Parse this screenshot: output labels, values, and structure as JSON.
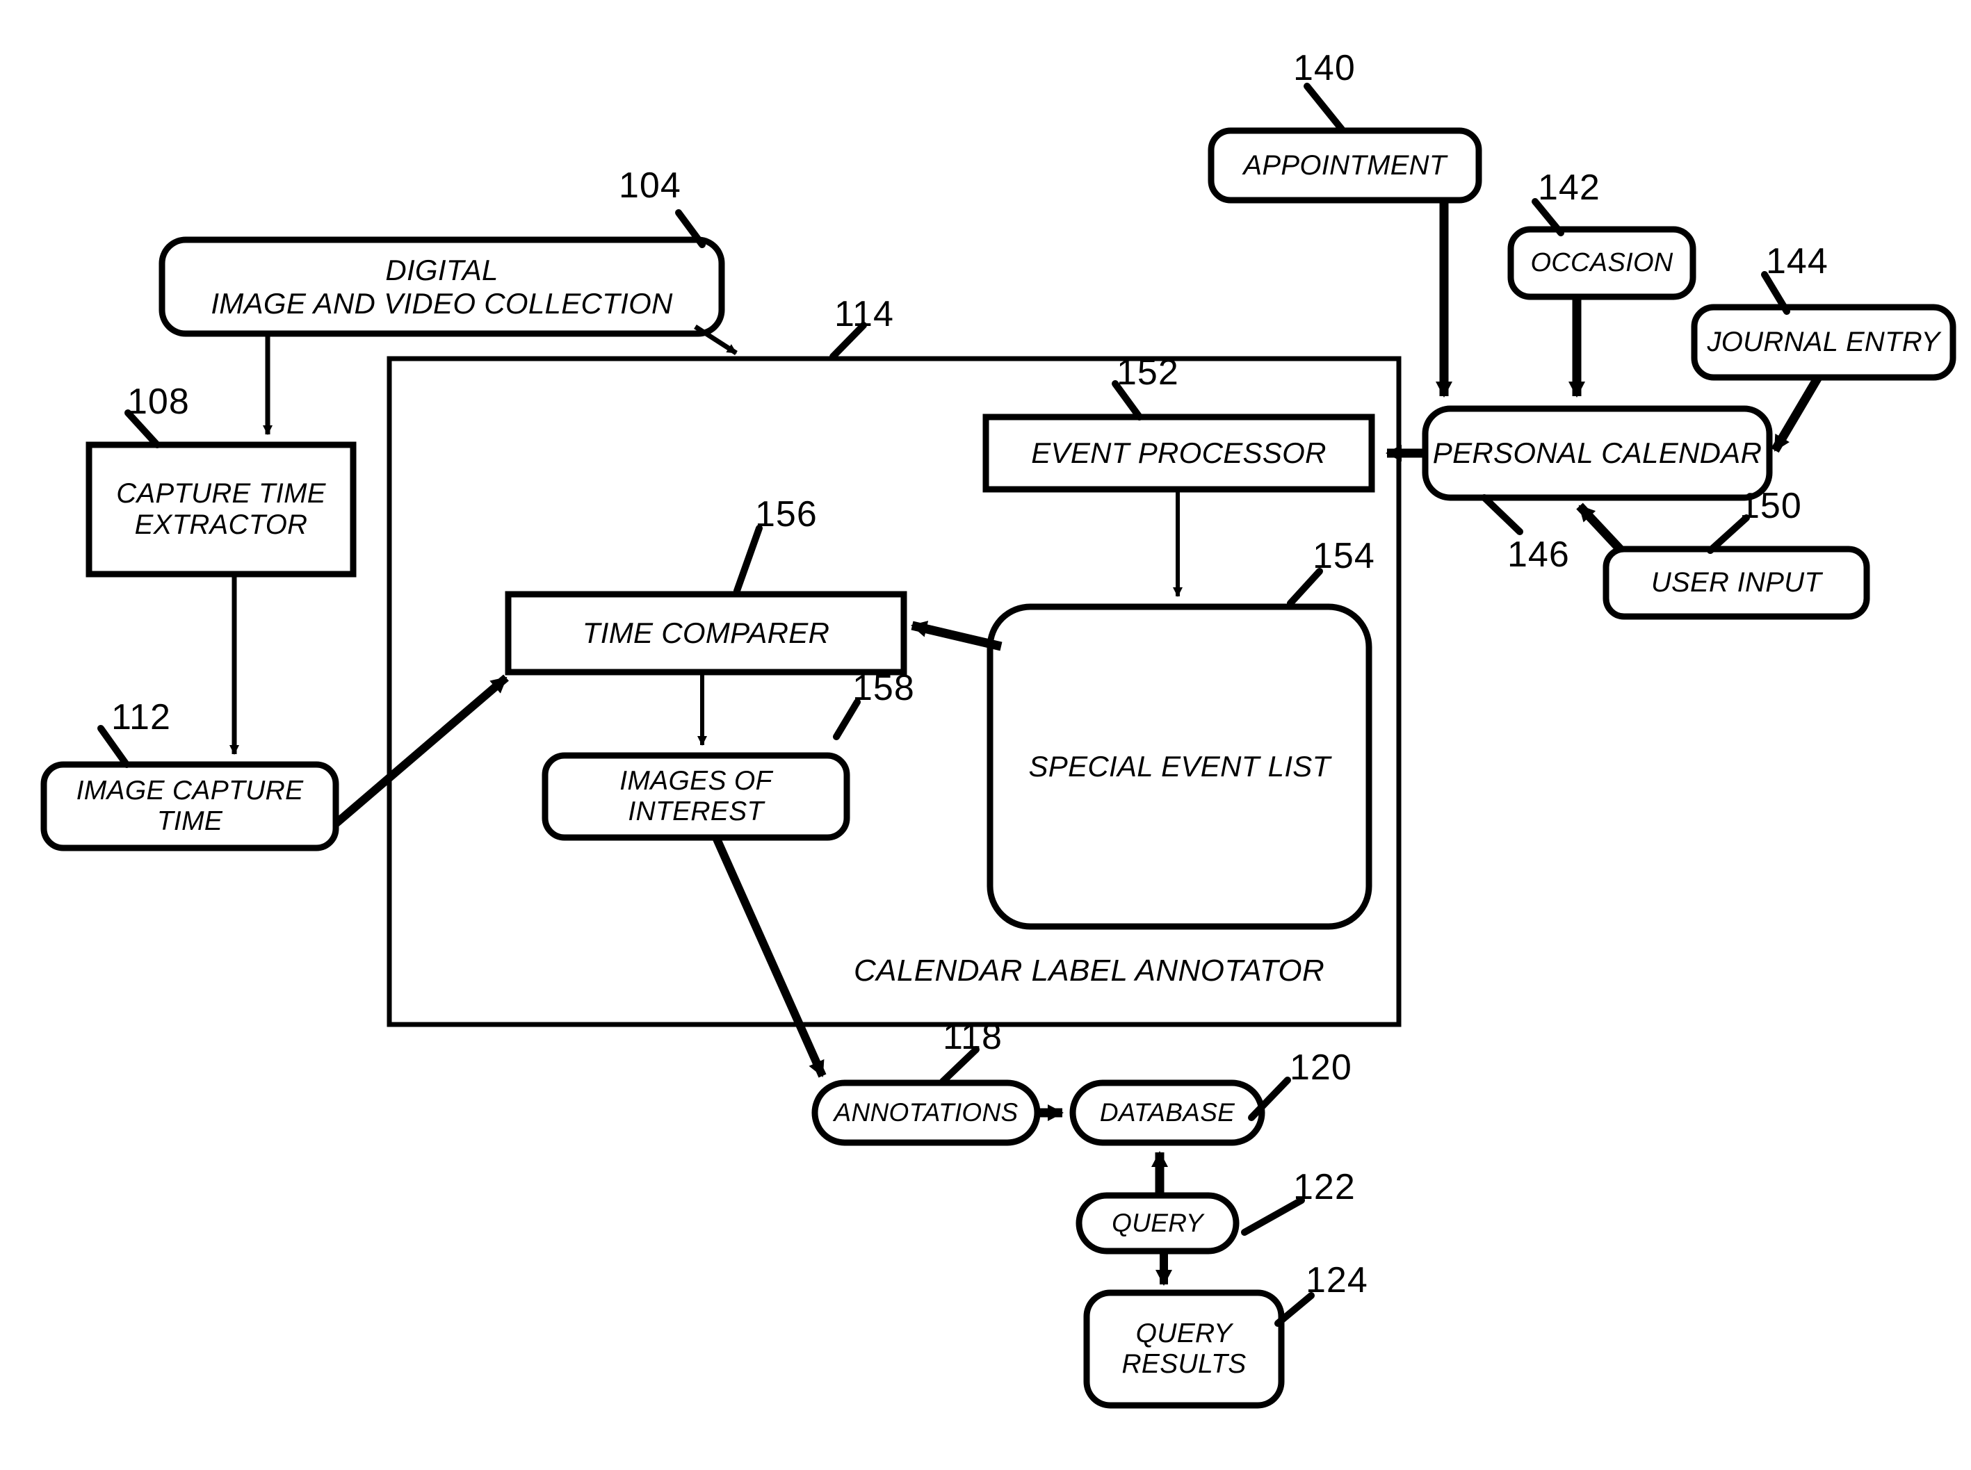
{
  "figure": {
    "type": "patent-block-diagram",
    "background_color": "#ffffff",
    "line_color": "#000000"
  },
  "nodes": {
    "digital_collection": {
      "label": "DIGITAL\nIMAGE AND VIDEO COLLECTION",
      "ref": "104",
      "shape": "rounded-rect"
    },
    "capture_time_extractor": {
      "label": "CAPTURE TIME\nEXTRACTOR",
      "ref": "108",
      "shape": "rect"
    },
    "image_capture_time": {
      "label": "IMAGE CAPTURE\nTIME",
      "ref": "112",
      "shape": "rounded-rect"
    },
    "time_comparer": {
      "label": "TIME COMPARER",
      "ref": "156",
      "shape": "rect"
    },
    "images_of_interest": {
      "label": "IMAGES OF\nINTEREST",
      "ref": "158",
      "shape": "rounded-rect"
    },
    "event_processor": {
      "label": "EVENT PROCESSOR",
      "ref": "152",
      "shape": "rect"
    },
    "special_event_list": {
      "label": "SPECIAL EVENT LIST",
      "ref": "154",
      "shape": "rounded-rect"
    },
    "calendar_label_annotator": {
      "label": "CALENDAR LABEL ANNOTATOR",
      "ref": "114",
      "shape": "rect-container"
    },
    "appointment": {
      "label": "APPOINTMENT",
      "ref": "140",
      "shape": "rounded-rect"
    },
    "occasion": {
      "label": "OCCASION",
      "ref": "142",
      "shape": "rounded-rect"
    },
    "journal_entry": {
      "label": "JOURNAL ENTRY",
      "ref": "144",
      "shape": "rounded-rect"
    },
    "personal_calendar": {
      "label": "PERSONAL CALENDAR",
      "ref": "146",
      "shape": "rounded-rect"
    },
    "user_input": {
      "label": "USER INPUT",
      "ref": "150",
      "shape": "rounded-rect"
    },
    "annotations": {
      "label": "ANNOTATIONS",
      "ref": "118",
      "shape": "pill"
    },
    "database": {
      "label": "DATABASE",
      "ref": "120",
      "shape": "pill"
    },
    "query": {
      "label": "QUERY",
      "ref": "122",
      "shape": "pill"
    },
    "query_results": {
      "label": "QUERY\nRESULTS",
      "ref": "124",
      "shape": "rounded-rect"
    }
  },
  "reference_numerals": [
    "104",
    "108",
    "112",
    "114",
    "118",
    "120",
    "122",
    "124",
    "140",
    "142",
    "144",
    "146",
    "150",
    "152",
    "154",
    "156",
    "158"
  ],
  "connections": [
    {
      "from": "digital_collection",
      "to": "capture_time_extractor",
      "style": "thin-arrow"
    },
    {
      "from": "digital_collection",
      "to": "calendar_label_annotator",
      "style": "thin-arrow"
    },
    {
      "from": "capture_time_extractor",
      "to": "image_capture_time",
      "style": "thin-arrow"
    },
    {
      "from": "image_capture_time",
      "to": "time_comparer",
      "style": "thick-arrow"
    },
    {
      "from": "time_comparer",
      "to": "images_of_interest",
      "style": "thin-arrow"
    },
    {
      "from": "special_event_list",
      "to": "time_comparer",
      "style": "thick-arrow"
    },
    {
      "from": "event_processor",
      "to": "special_event_list",
      "style": "thin-arrow"
    },
    {
      "from": "personal_calendar",
      "to": "event_processor",
      "style": "thick-arrow"
    },
    {
      "from": "appointment",
      "to": "personal_calendar",
      "style": "thick-arrow"
    },
    {
      "from": "occasion",
      "to": "personal_calendar",
      "style": "thick-arrow"
    },
    {
      "from": "journal_entry",
      "to": "personal_calendar",
      "style": "thick-arrow"
    },
    {
      "from": "user_input",
      "to": "personal_calendar",
      "style": "thick-arrow"
    },
    {
      "from": "images_of_interest",
      "to": "annotations",
      "style": "thick-arrow"
    },
    {
      "from": "annotations",
      "to": "database",
      "style": "thick-arrow"
    },
    {
      "from": "query",
      "to": "database",
      "style": "thick-arrow"
    },
    {
      "from": "query",
      "to": "query_results",
      "style": "thick-arrow"
    }
  ]
}
